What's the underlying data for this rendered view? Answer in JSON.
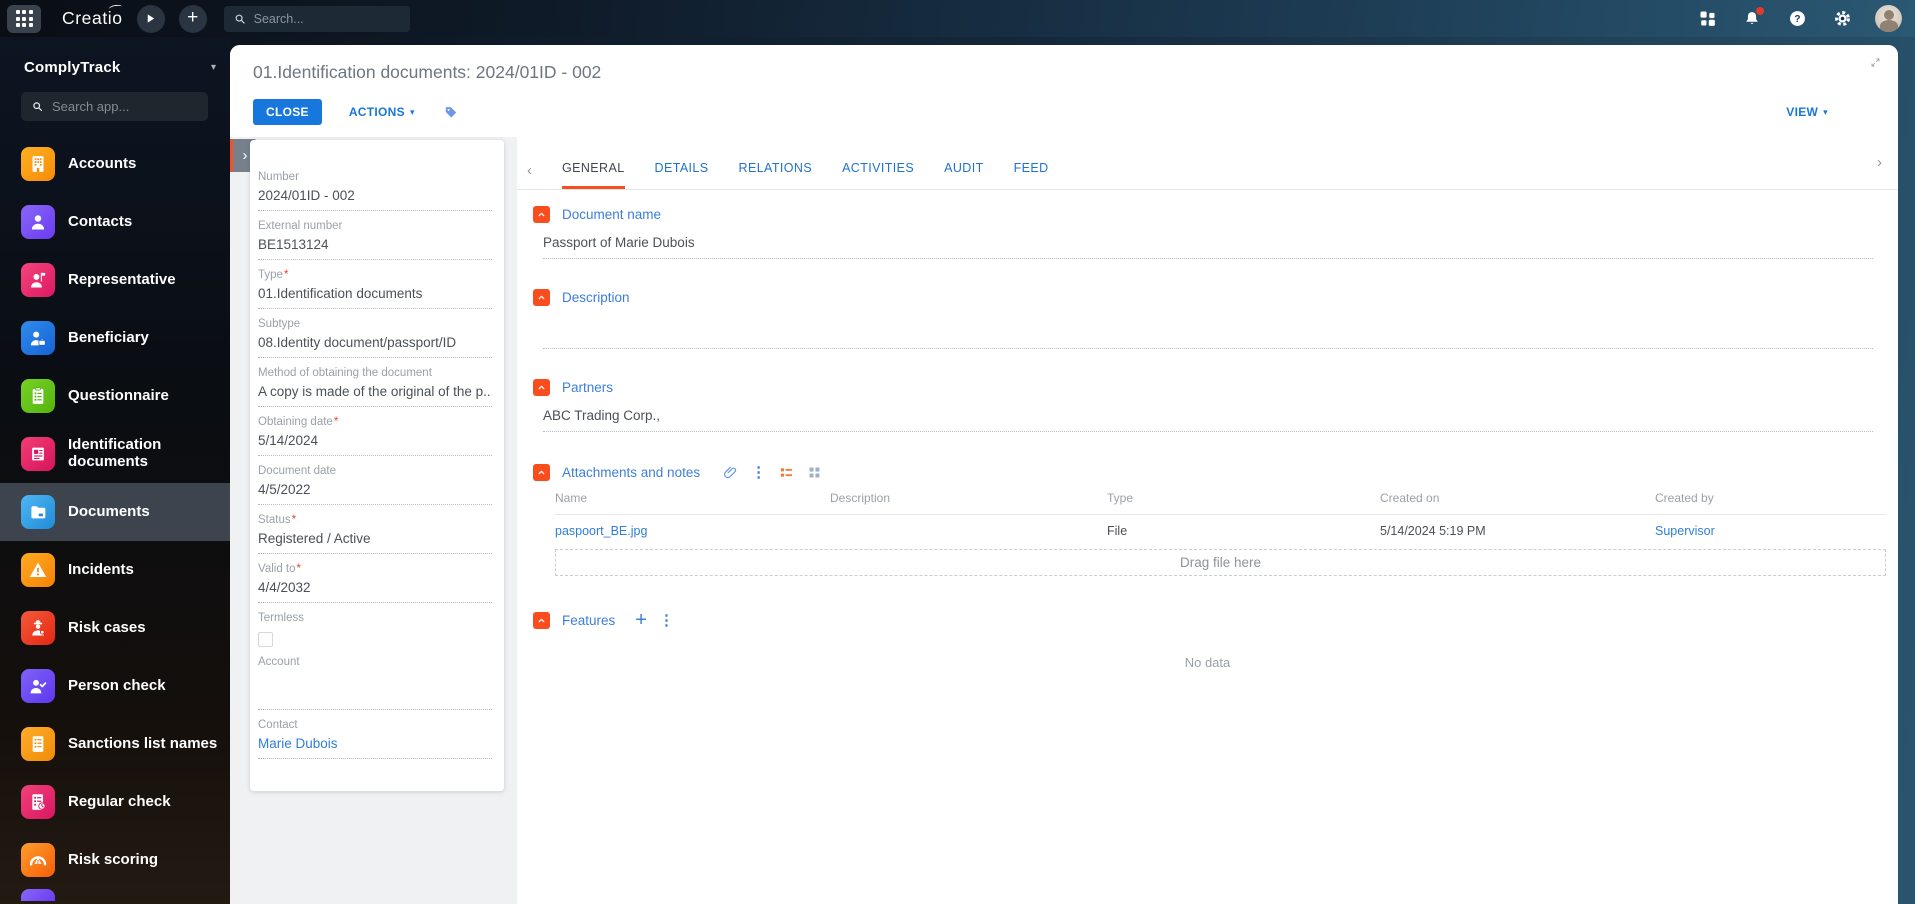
{
  "colors": {
    "accent_orange": "#f94d1e",
    "link_blue": "#1b76db",
    "close_button_blue": "#1877dd"
  },
  "topbar": {
    "logo": "Creatio",
    "search_placeholder": "Search...",
    "has_notification_dot": true
  },
  "sidebar": {
    "workspace": "ComplyTrack",
    "app_search_placeholder": "Search app...",
    "items": [
      {
        "label": "Accounts",
        "icon": "building-icon",
        "colors": [
          "#ffb023",
          "#f78b07"
        ]
      },
      {
        "label": "Contacts",
        "icon": "person-icon",
        "colors": [
          "#8a67f8",
          "#6a3bf0"
        ]
      },
      {
        "label": "Representative",
        "icon": "representative-icon",
        "colors": [
          "#f4467e",
          "#dd1762"
        ]
      },
      {
        "label": "Beneficiary",
        "icon": "person-briefcase-icon",
        "colors": [
          "#2e8ceb",
          "#1563d6"
        ]
      },
      {
        "label": "Questionnaire",
        "icon": "clipboard-icon",
        "colors": [
          "#79d224",
          "#53b30e"
        ]
      },
      {
        "label": "Identification documents",
        "icon": "id-card-icon",
        "colors": [
          "#f23f74",
          "#d8125c"
        ]
      },
      {
        "label": "Documents",
        "icon": "folder-icon",
        "colors": [
          "#4fb6f4",
          "#1f8cd8"
        ],
        "selected": true
      },
      {
        "label": "Incidents",
        "icon": "warning-icon",
        "colors": [
          "#ffab24",
          "#f58206"
        ]
      },
      {
        "label": "Risk cases",
        "icon": "detective-icon",
        "colors": [
          "#f45a3b",
          "#e42613"
        ]
      },
      {
        "label": "Person check",
        "icon": "person-check-icon",
        "colors": [
          "#8063f7",
          "#5c36ee"
        ]
      },
      {
        "label": "Sanctions list names",
        "icon": "checklist-icon",
        "colors": [
          "#fcae2a",
          "#f28a05"
        ]
      },
      {
        "label": "Regular check",
        "icon": "checklist-clock-icon",
        "colors": [
          "#f2427b",
          "#da1560"
        ]
      },
      {
        "label": "Risk scoring",
        "icon": "gauge-icon",
        "colors": [
          "#ff9d2d",
          "#f55e07"
        ]
      }
    ]
  },
  "page": {
    "title": "01.Identification documents: 2024/01ID - 002",
    "close_label": "CLOSE",
    "actions_label": "ACTIONS",
    "view_label": "VIEW"
  },
  "record": {
    "fields": [
      {
        "label": "Number",
        "value": "2024/01ID - 002"
      },
      {
        "label": "External number",
        "value": "BE1513124"
      },
      {
        "label": "Type",
        "required": true,
        "value": "01.Identification documents"
      },
      {
        "label": "Subtype",
        "value": "08.Identity document/passport/ID"
      },
      {
        "label": "Method of obtaining the document",
        "value": "A copy is made of the original of the p..."
      },
      {
        "label": "Obtaining date",
        "required": true,
        "value": "5/14/2024"
      },
      {
        "label": "Document date",
        "value": "4/5/2022"
      },
      {
        "label": "Status",
        "required": true,
        "value": "Registered / Active"
      },
      {
        "label": "Valid to",
        "required": true,
        "value": "4/4/2032"
      },
      {
        "label": "Termless",
        "type": "checkbox",
        "checked": false
      },
      {
        "label": "Account",
        "type": "empty",
        "value": ""
      },
      {
        "label": "Contact",
        "type": "link",
        "value": "Marie Dubois"
      }
    ]
  },
  "tabs": {
    "active": "GENERAL",
    "items": [
      "GENERAL",
      "DETAILS",
      "RELATIONS",
      "ACTIVITIES",
      "AUDIT",
      "FEED"
    ]
  },
  "sections": {
    "document_name": {
      "title": "Document name",
      "value": "Passport of Marie Dubois"
    },
    "description": {
      "title": "Description",
      "value": ""
    },
    "partners": {
      "title": "Partners",
      "value": "ABC Trading Corp.,"
    },
    "attachments": {
      "title": "Attachments and notes",
      "columns": [
        "Name",
        "Description",
        "Type",
        "Created on",
        "Created by"
      ],
      "rows": [
        {
          "Name": "paspoort_BE.jpg",
          "Description": "",
          "Type": "File",
          "Created on": "5/14/2024 5:19 PM",
          "Created by": "Supervisor"
        }
      ],
      "dropzone_label": "Drag file here"
    },
    "features": {
      "title": "Features",
      "empty_label": "No data"
    }
  }
}
